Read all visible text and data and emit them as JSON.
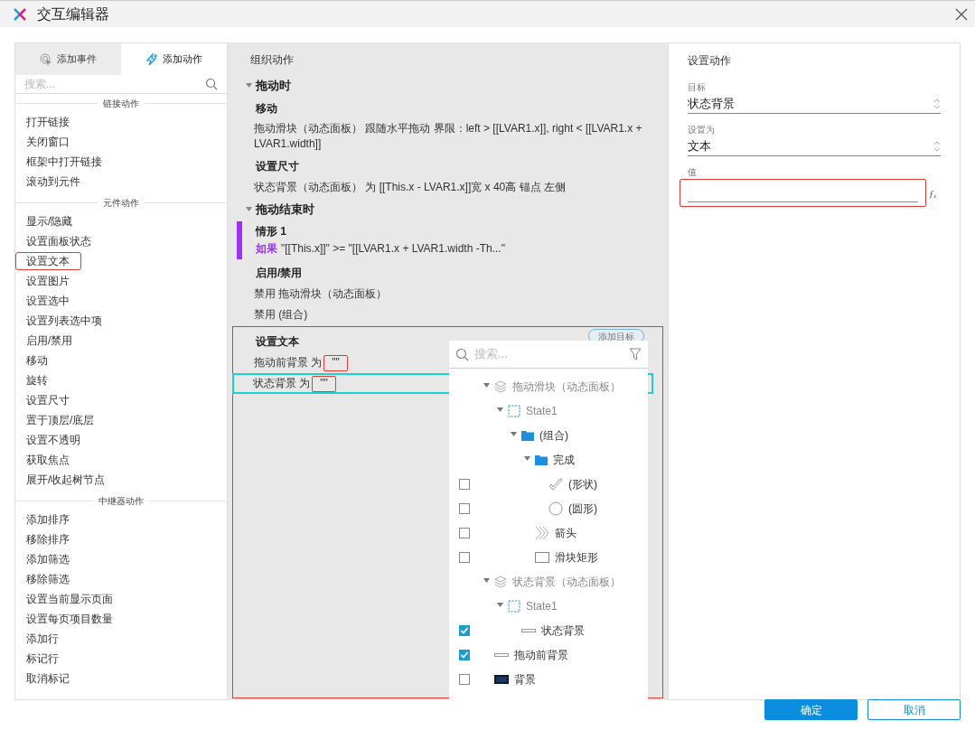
{
  "window": {
    "title": "交互编辑器"
  },
  "left_panel": {
    "tabs": [
      {
        "label": "添加事件",
        "selected": false
      },
      {
        "label": "添加动作",
        "selected": true
      }
    ],
    "search": {
      "placeholder": "搜索..."
    },
    "sections": [
      {
        "title": "链接动作",
        "items": [
          {
            "label": "打开链接",
            "annotated": false
          },
          {
            "label": "关闭窗口",
            "annotated": false
          },
          {
            "label": "框架中打开链接",
            "annotated": false
          },
          {
            "label": "滚动到元件",
            "annotated": false
          }
        ]
      },
      {
        "title": "元件动作",
        "items": [
          {
            "label": "显示/隐藏",
            "annotated": false
          },
          {
            "label": "设置面板状态",
            "annotated": false
          },
          {
            "label": "设置文本",
            "annotated": true
          },
          {
            "label": "设置图片",
            "annotated": false
          },
          {
            "label": "设置选中",
            "annotated": false
          },
          {
            "label": "设置列表选中项",
            "annotated": false
          },
          {
            "label": "启用/禁用",
            "annotated": false
          },
          {
            "label": "移动",
            "annotated": false
          },
          {
            "label": "旋转",
            "annotated": false
          },
          {
            "label": "设置尺寸",
            "annotated": false
          },
          {
            "label": "置于顶层/底层",
            "annotated": false
          },
          {
            "label": "设置不透明",
            "annotated": false
          },
          {
            "label": "获取焦点",
            "annotated": false
          },
          {
            "label": "展开/收起树节点",
            "annotated": false
          }
        ]
      },
      {
        "title": "中继器动作",
        "items": [
          {
            "label": "添加排序",
            "annotated": false
          },
          {
            "label": "移除排序",
            "annotated": false
          },
          {
            "label": "添加筛选",
            "annotated": false
          },
          {
            "label": "移除筛选",
            "annotated": false
          },
          {
            "label": "设置当前显示页面",
            "annotated": false
          },
          {
            "label": "设置每页项目数量",
            "annotated": false
          },
          {
            "label": "添加行",
            "annotated": false
          },
          {
            "label": "标记行",
            "annotated": false
          },
          {
            "label": "取消标记",
            "annotated": false
          }
        ]
      }
    ]
  },
  "middle_panel": {
    "title": "组织动作",
    "events": [
      {
        "label": "拖动时",
        "expanded": true,
        "items": [
          {
            "kind": "action",
            "title": "移动",
            "annotated": false,
            "lines": [
              {
                "text": "拖动滑块（动态面板） 跟随水平拖动 界限：left > [[LVAR1.x]], right < [[LVAR1.x + LVAR1.width]]",
                "selected": false
              }
            ]
          },
          {
            "kind": "action",
            "title": "设置尺寸",
            "annotated": false,
            "lines": [
              {
                "text": "状态背景（动态面板） 为 [[This.x - LVAR1.x]]宽 x 40高  锚点 左侧",
                "selected": false
              }
            ]
          }
        ]
      },
      {
        "label": "拖动结束时",
        "expanded": true,
        "items": [
          {
            "kind": "case",
            "title": "情形 1",
            "keyword": "如果",
            "condition": "\"[[This.x]]\" >= \"[[LVAR1.x + LVAR1.width -Th...\"",
            "color": "#9b30ff"
          },
          {
            "kind": "action",
            "title": "启用/禁用",
            "annotated": false,
            "lines": [
              {
                "text": "禁用 拖动滑块（动态面板）",
                "selected": false
              },
              {
                "text": "禁用 (组合)",
                "selected": false
              }
            ]
          },
          {
            "kind": "action",
            "title": "设置文本",
            "annotated": true,
            "add_target": "添加目标",
            "lines": [
              {
                "text": "拖动前背景 为",
                "value": "\"\"",
                "selected": false
              },
              {
                "text": "状态背景 为",
                "value": "\"\"",
                "selected": true
              }
            ]
          }
        ]
      }
    ]
  },
  "target_picker": {
    "search": {
      "placeholder": "搜索..."
    },
    "tree": [
      {
        "label": "拖动滑块（动态面板）",
        "kind": "panel",
        "expanded": true,
        "children": [
          {
            "label": "State1",
            "kind": "state",
            "expanded": true,
            "children": [
              {
                "label": "(组合)",
                "kind": "group",
                "expanded": true,
                "children": [
                  {
                    "label": "完成",
                    "kind": "group",
                    "expanded": true,
                    "children": [
                      {
                        "label": "(形状)",
                        "kind": "check",
                        "checked": false
                      },
                      {
                        "label": "(圆形)",
                        "kind": "circle",
                        "checked": false
                      }
                    ]
                  },
                  {
                    "label": "箭头",
                    "kind": "chevrons",
                    "checked": false
                  },
                  {
                    "label": "滑块矩形",
                    "kind": "rect",
                    "checked": false
                  }
                ]
              }
            ]
          }
        ]
      },
      {
        "label": "状态背景（动态面板）",
        "kind": "panel",
        "expanded": true,
        "children": [
          {
            "label": "State1",
            "kind": "state",
            "expanded": true,
            "children": [
              {
                "label": "状态背景",
                "kind": "line",
                "checked": true
              }
            ]
          }
        ]
      },
      {
        "label": "拖动前背景",
        "kind": "line",
        "checked": true
      },
      {
        "label": "背景",
        "kind": "image",
        "checked": false
      }
    ]
  },
  "right_panel": {
    "title": "设置动作",
    "fields": [
      {
        "kind": "select",
        "label": "目标",
        "value": "状态背景"
      },
      {
        "kind": "select",
        "label": "设置为",
        "value": "文本"
      },
      {
        "kind": "text",
        "label": "值",
        "annotated": true,
        "button": "ƒₓ"
      }
    ]
  },
  "buttons": [
    {
      "label": "确定",
      "primary": true
    },
    {
      "label": "取消",
      "primary": false
    }
  ]
}
